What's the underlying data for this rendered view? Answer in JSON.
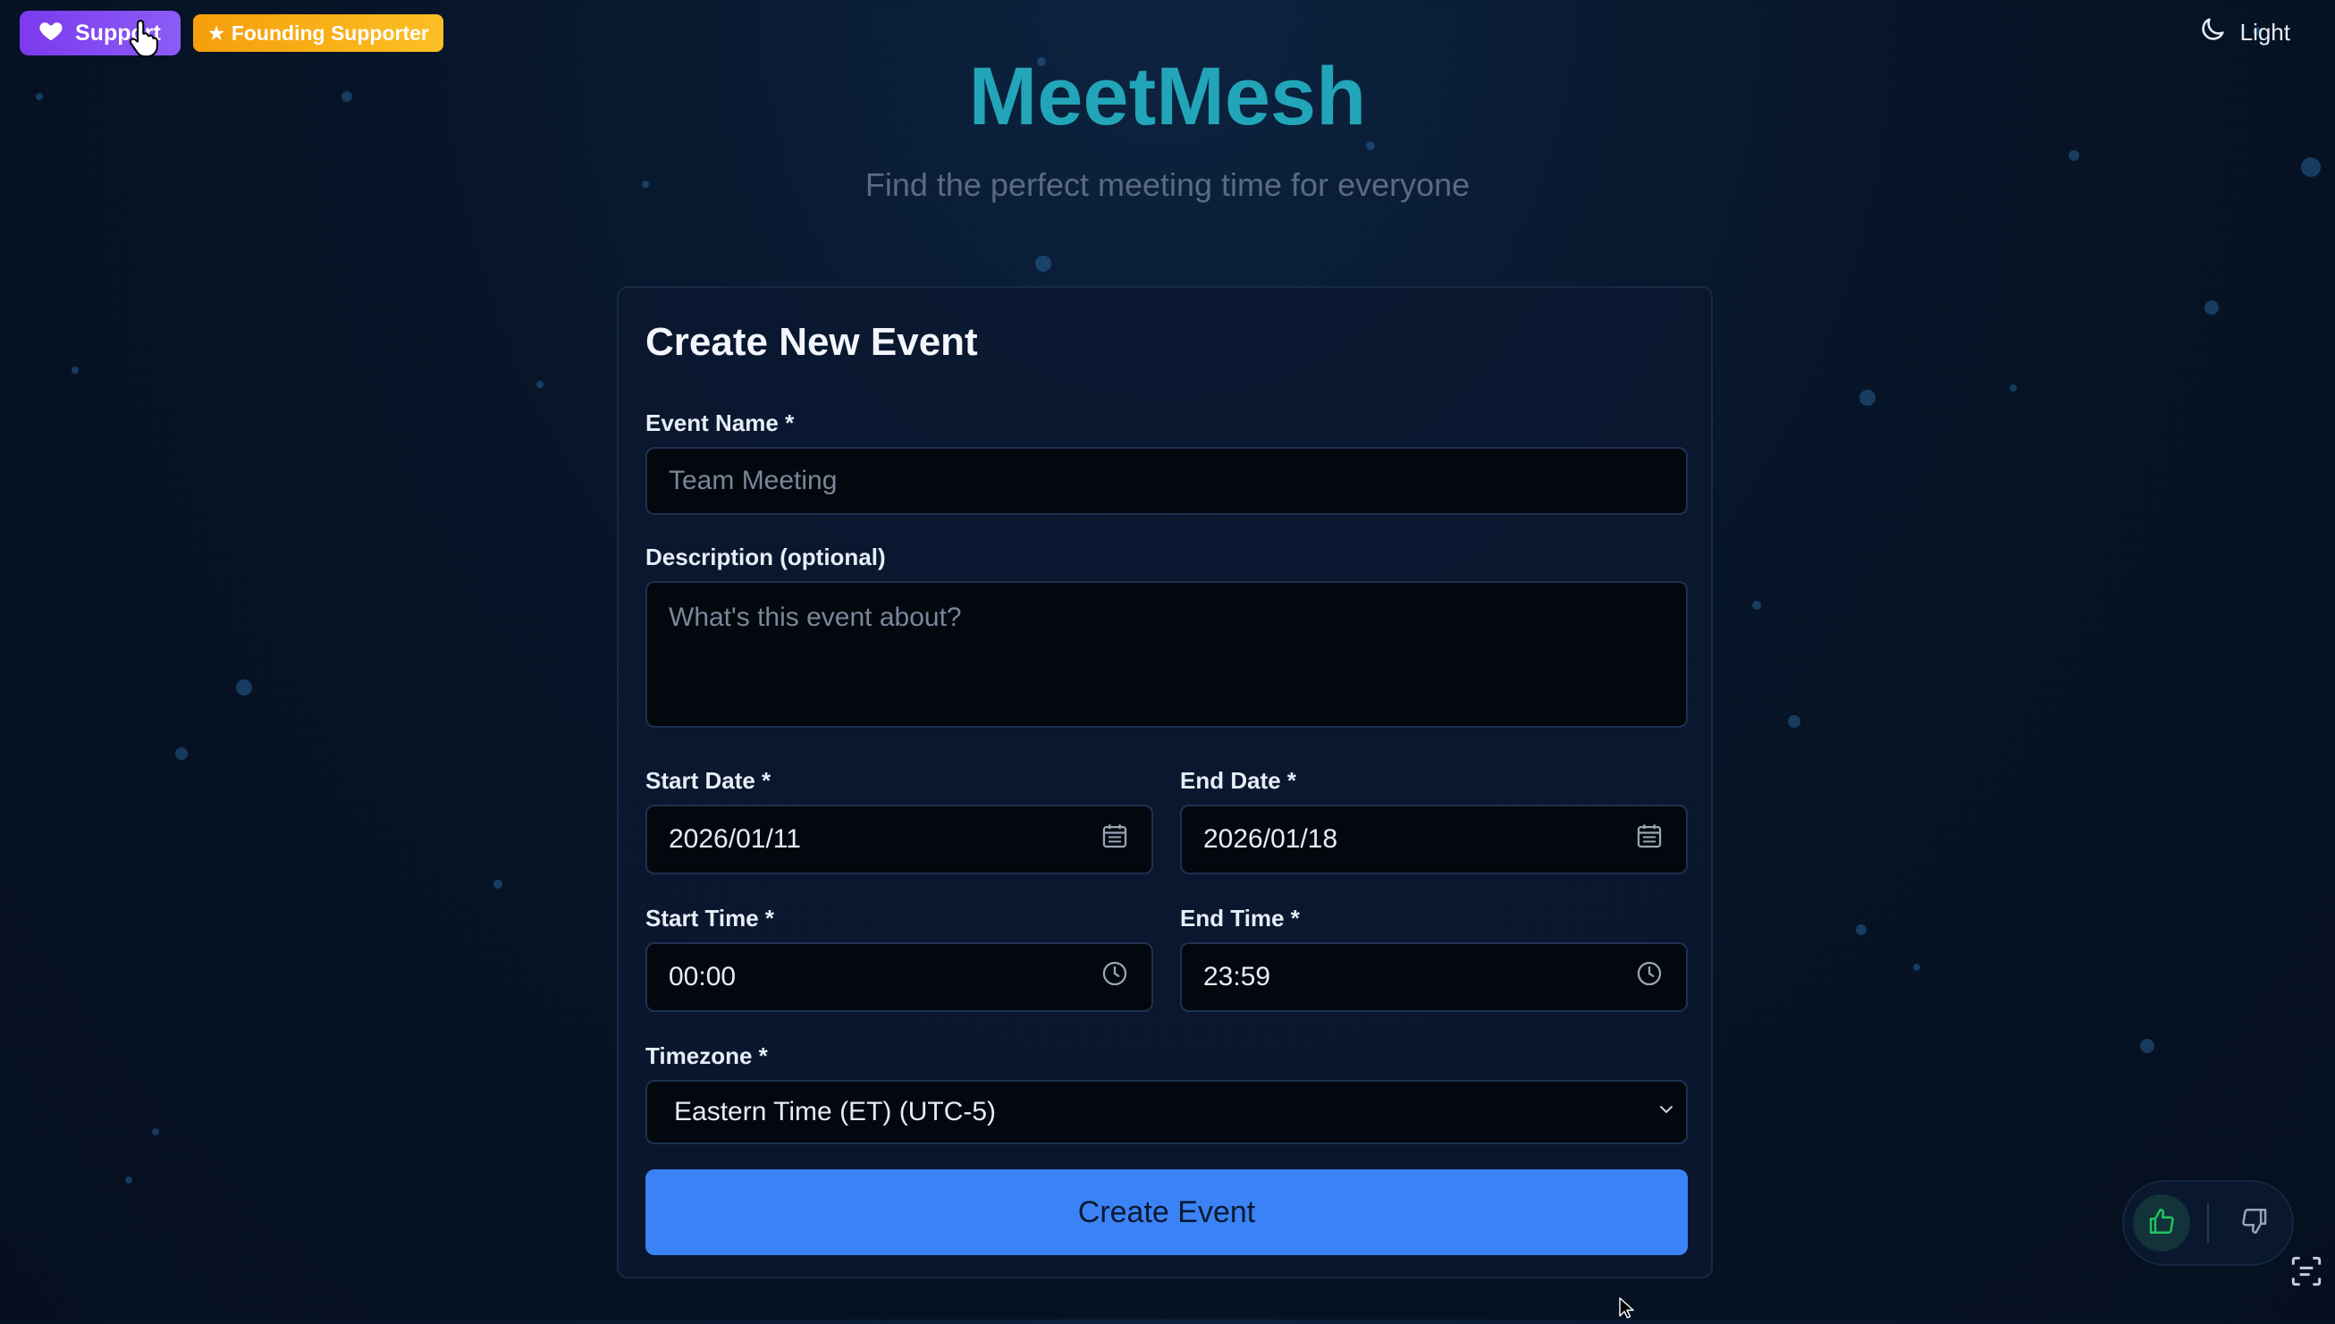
{
  "header": {
    "support_label": "Support",
    "founding_label": "★ Founding Supporter",
    "theme_label": "Light",
    "title": "MeetMesh",
    "subtitle": "Find the perfect meeting time for everyone"
  },
  "form": {
    "title": "Create New Event",
    "event_name": {
      "label": "Event Name *",
      "placeholder": "Team Meeting",
      "value": ""
    },
    "description": {
      "label": "Description (optional)",
      "placeholder": "What's this event about?",
      "value": ""
    },
    "start_date": {
      "label": "Start Date *",
      "value": "2026/01/11"
    },
    "end_date": {
      "label": "End Date *",
      "value": "2026/01/18"
    },
    "start_time": {
      "label": "Start Time *",
      "value": "00:00"
    },
    "end_time": {
      "label": "End Time *",
      "value": "23:59"
    },
    "timezone": {
      "label": "Timezone *",
      "value": "Eastern Time (ET) (UTC-5)"
    },
    "submit_label": "Create Event"
  },
  "icons": {
    "support": "heart-icon",
    "theme": "moon-icon",
    "date": "calendar-icon",
    "time": "clock-icon",
    "select": "chevron-down-icon",
    "thumbs_up": "thumbs-up-icon",
    "thumbs_down": "thumbs-down-icon"
  },
  "colors": {
    "support_button": "#7c3aed",
    "founding_badge": "#f59e0b",
    "title": "#22a5b8",
    "primary_button": "#3b82f6",
    "thumbs_up": "#22c55e"
  }
}
